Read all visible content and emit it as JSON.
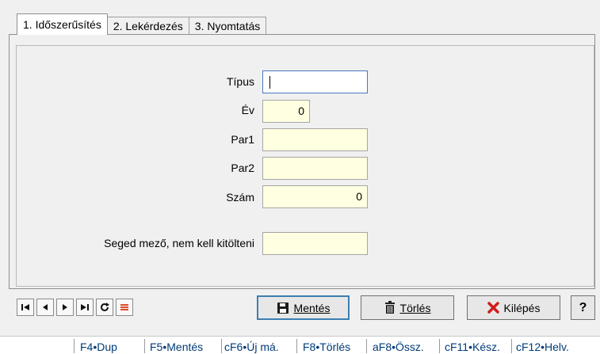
{
  "tabs": [
    {
      "label": "1. Időszerűsítés",
      "active": true
    },
    {
      "label": "2. Lekérdezés",
      "active": false
    },
    {
      "label": "3. Nyomtatás",
      "active": false
    }
  ],
  "form": {
    "tipus": {
      "label": "Típus",
      "value": ""
    },
    "ev": {
      "label": "Év",
      "value": "0"
    },
    "par1": {
      "label": "Par1",
      "value": ""
    },
    "par2": {
      "label": "Par2",
      "value": ""
    },
    "szam": {
      "label": "Szám",
      "value": "0"
    },
    "seged": {
      "label": "Seged mező, nem kell kitölteni",
      "value": ""
    }
  },
  "buttons": {
    "save": "Mentés",
    "delete": "Törlés",
    "exit": "Kilépés",
    "help": "?"
  },
  "icons": {
    "first": "first-record-icon",
    "prev": "previous-record-icon",
    "next": "next-record-icon",
    "last": "last-record-icon",
    "refresh": "refresh-icon",
    "list": "list-icon",
    "save": "floppy-disk-icon",
    "delete": "trash-icon",
    "exit": "red-x-icon"
  },
  "colors": {
    "required_field": "#ffffe1",
    "list_icon": "#e04a2a",
    "exit_icon": "#d01c1c"
  },
  "statusbar": [
    "F4•Dup",
    "F5•Mentés",
    "cF6•Új má.",
    "F8•Törlés",
    "aF8•Össz.",
    "cF11•Kész.",
    "cF12•Helv."
  ]
}
